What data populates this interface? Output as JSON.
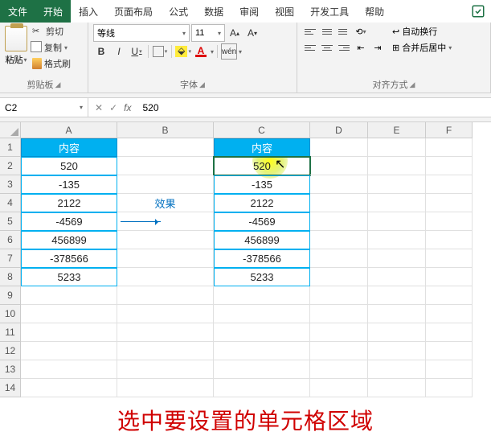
{
  "tabs": {
    "file": "文件",
    "home": "开始",
    "insert": "插入",
    "layout": "页面布局",
    "formulas": "公式",
    "data": "数据",
    "review": "审阅",
    "view": "视图",
    "dev": "开发工具",
    "help": "帮助"
  },
  "ribbon": {
    "clipboard": {
      "paste": "粘贴",
      "cut": "剪切",
      "copy": "复制",
      "format_painter": "格式刷",
      "label": "剪贴板"
    },
    "font": {
      "name": "等线",
      "size": "11",
      "label": "字体",
      "wen": "wén"
    },
    "align": {
      "wrap": "自动换行",
      "merge": "合并后居中",
      "label": "对齐方式"
    }
  },
  "formula_bar": {
    "name_box": "C2",
    "formula": "520"
  },
  "columns": [
    "A",
    "B",
    "C",
    "D",
    "E",
    "F"
  ],
  "rows": [
    "1",
    "2",
    "3",
    "4",
    "5",
    "6",
    "7",
    "8",
    "9",
    "10",
    "11",
    "12",
    "13",
    "14"
  ],
  "sheet": {
    "headerA": "内容",
    "headerC": "内容",
    "colA": [
      "520",
      "-135",
      "2122",
      "-4569",
      "456899",
      "-378566",
      "5233"
    ],
    "colC": [
      "520",
      "-135",
      "2122",
      "-4569",
      "456899",
      "-378566",
      "5233"
    ],
    "effect_label": "效果"
  },
  "annotation": "选中要设置的单元格区域"
}
